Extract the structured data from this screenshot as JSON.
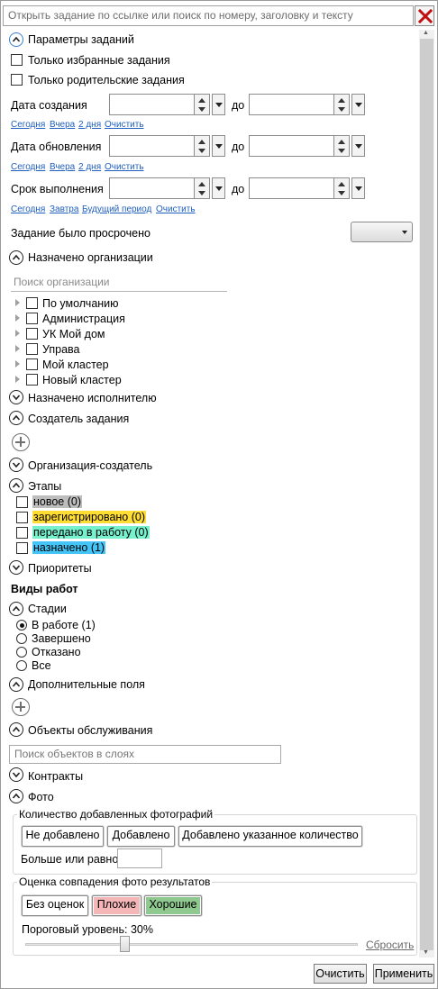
{
  "search": {
    "placeholder": "Открыть задание по ссылке или поиск по номеру, заголовку и тексту"
  },
  "sections": {
    "params": "Параметры заданий",
    "assigned_org": "Назначено организации",
    "assigned_exec": "Назначено исполнителю",
    "creator": "Создатель задания",
    "creator_org": "Организация-создатель",
    "stages": "Этапы",
    "priorities": "Приоритеты",
    "work_types": "Виды работ",
    "phases": "Стадии",
    "extra_fields": "Дополнительные поля",
    "service_objects": "Объекты обслуживания",
    "contracts": "Контракты",
    "photo": "Фото"
  },
  "filters": {
    "favorites_only": "Только избранные задания",
    "parents_only": "Только родительские задания",
    "created_label": "Дата создания",
    "updated_label": "Дата обновления",
    "due_label": "Срок выполнения",
    "to": "до",
    "overdue_label": "Задание было просрочено"
  },
  "quick_links": {
    "created": [
      "Сегодня",
      "Вчера",
      "2 дня",
      "Очистить"
    ],
    "updated": [
      "Сегодня",
      "Вчера",
      "2 дня",
      "Очистить"
    ],
    "due": [
      "Сегодня",
      "Завтра",
      "Будущий период",
      "Очистить"
    ]
  },
  "org_search": {
    "placeholder": "Поиск организации"
  },
  "orgs": [
    "По умолчанию",
    "Администрация",
    "УК Мой дом",
    "Управа",
    "Мой кластер",
    "Новый кластер"
  ],
  "stages": [
    {
      "label": "новое (0)",
      "color": "#bdbdbd"
    },
    {
      "label": "зарегистрировано (0)",
      "color": "#ffdd33"
    },
    {
      "label": "передано в работу (0)",
      "color": "#77f0cc"
    },
    {
      "label": "назначено (1)",
      "color": "#44c4f7"
    }
  ],
  "phases": [
    {
      "label": "В работе (1)",
      "selected": true
    },
    {
      "label": "Завершено",
      "selected": false
    },
    {
      "label": "Отказано",
      "selected": false
    },
    {
      "label": "Все",
      "selected": false
    }
  ],
  "layers_search": {
    "placeholder": "Поиск объектов в слоях"
  },
  "photo": {
    "count_group": "Количество добавленных фотографий",
    "btn_not_added": "Не добавлено",
    "btn_added": "Добавлено",
    "btn_added_count": "Добавлено указанное количество",
    "ge_label": "Больше или равно",
    "rating_group": "Оценка совпадения фото результатов",
    "btn_no_rating": "Без оценок",
    "btn_bad": "Плохие",
    "btn_good": "Хорошие",
    "bad_color": "#f4b6b6",
    "good_color": "#8fc98f",
    "threshold_label": "Пороговый уровень: 30%",
    "threshold_value": 0.3,
    "reset": "Сбросить"
  },
  "footer": {
    "clear": "Очистить",
    "apply": "Применить"
  }
}
